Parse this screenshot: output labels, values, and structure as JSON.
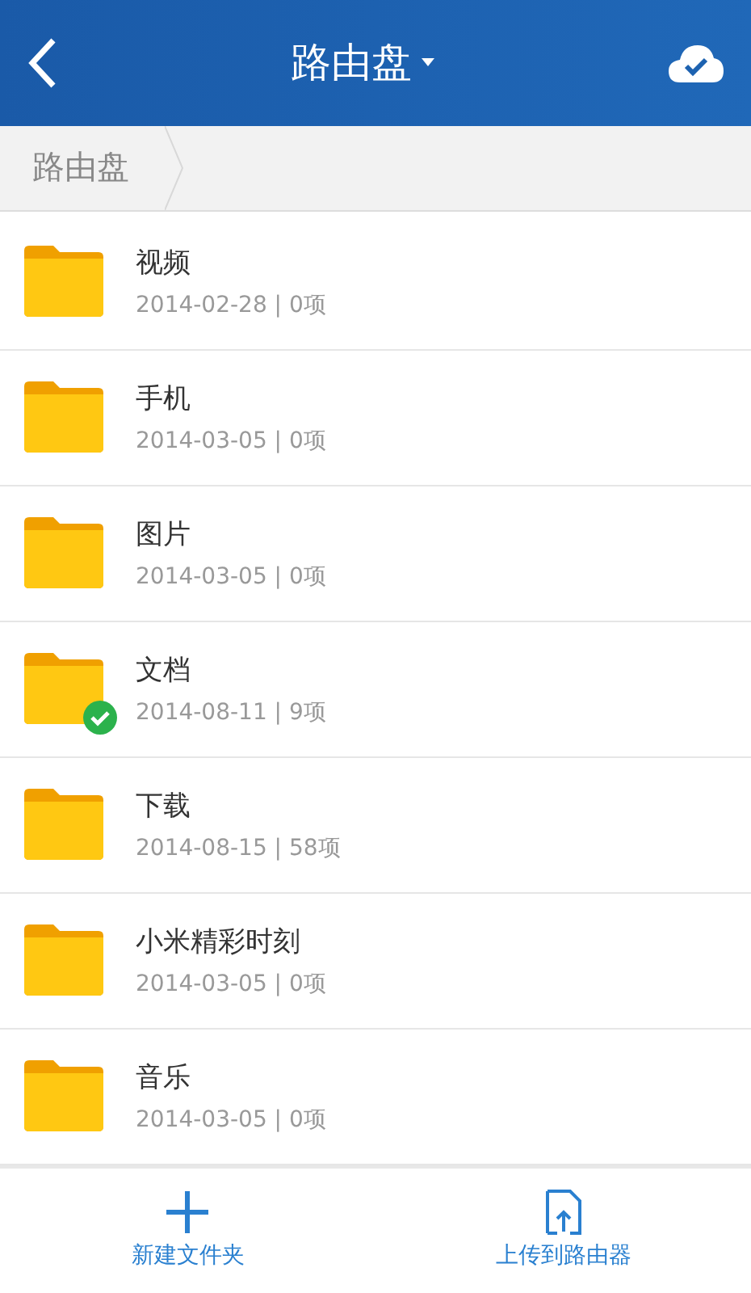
{
  "header": {
    "title": "路由盘"
  },
  "breadcrumb": [
    "路由盘"
  ],
  "folders": [
    {
      "name": "视频",
      "meta": "2014-02-28 | 0项",
      "synced": false
    },
    {
      "name": "手机",
      "meta": "2014-03-05 | 0项",
      "synced": false
    },
    {
      "name": "图片",
      "meta": "2014-03-05 | 0项",
      "synced": false
    },
    {
      "name": "文档",
      "meta": "2014-08-11 | 9项",
      "synced": true
    },
    {
      "name": "下载",
      "meta": "2014-08-15 | 58项",
      "synced": false
    },
    {
      "name": "小米精彩时刻",
      "meta": "2014-03-05 | 0项",
      "synced": false
    },
    {
      "name": "音乐",
      "meta": "2014-03-05 | 0项",
      "synced": false
    }
  ],
  "actions": [
    {
      "kind": "new",
      "label": "新建文件夹"
    },
    {
      "kind": "upload",
      "label": "上传到路由器"
    }
  ]
}
